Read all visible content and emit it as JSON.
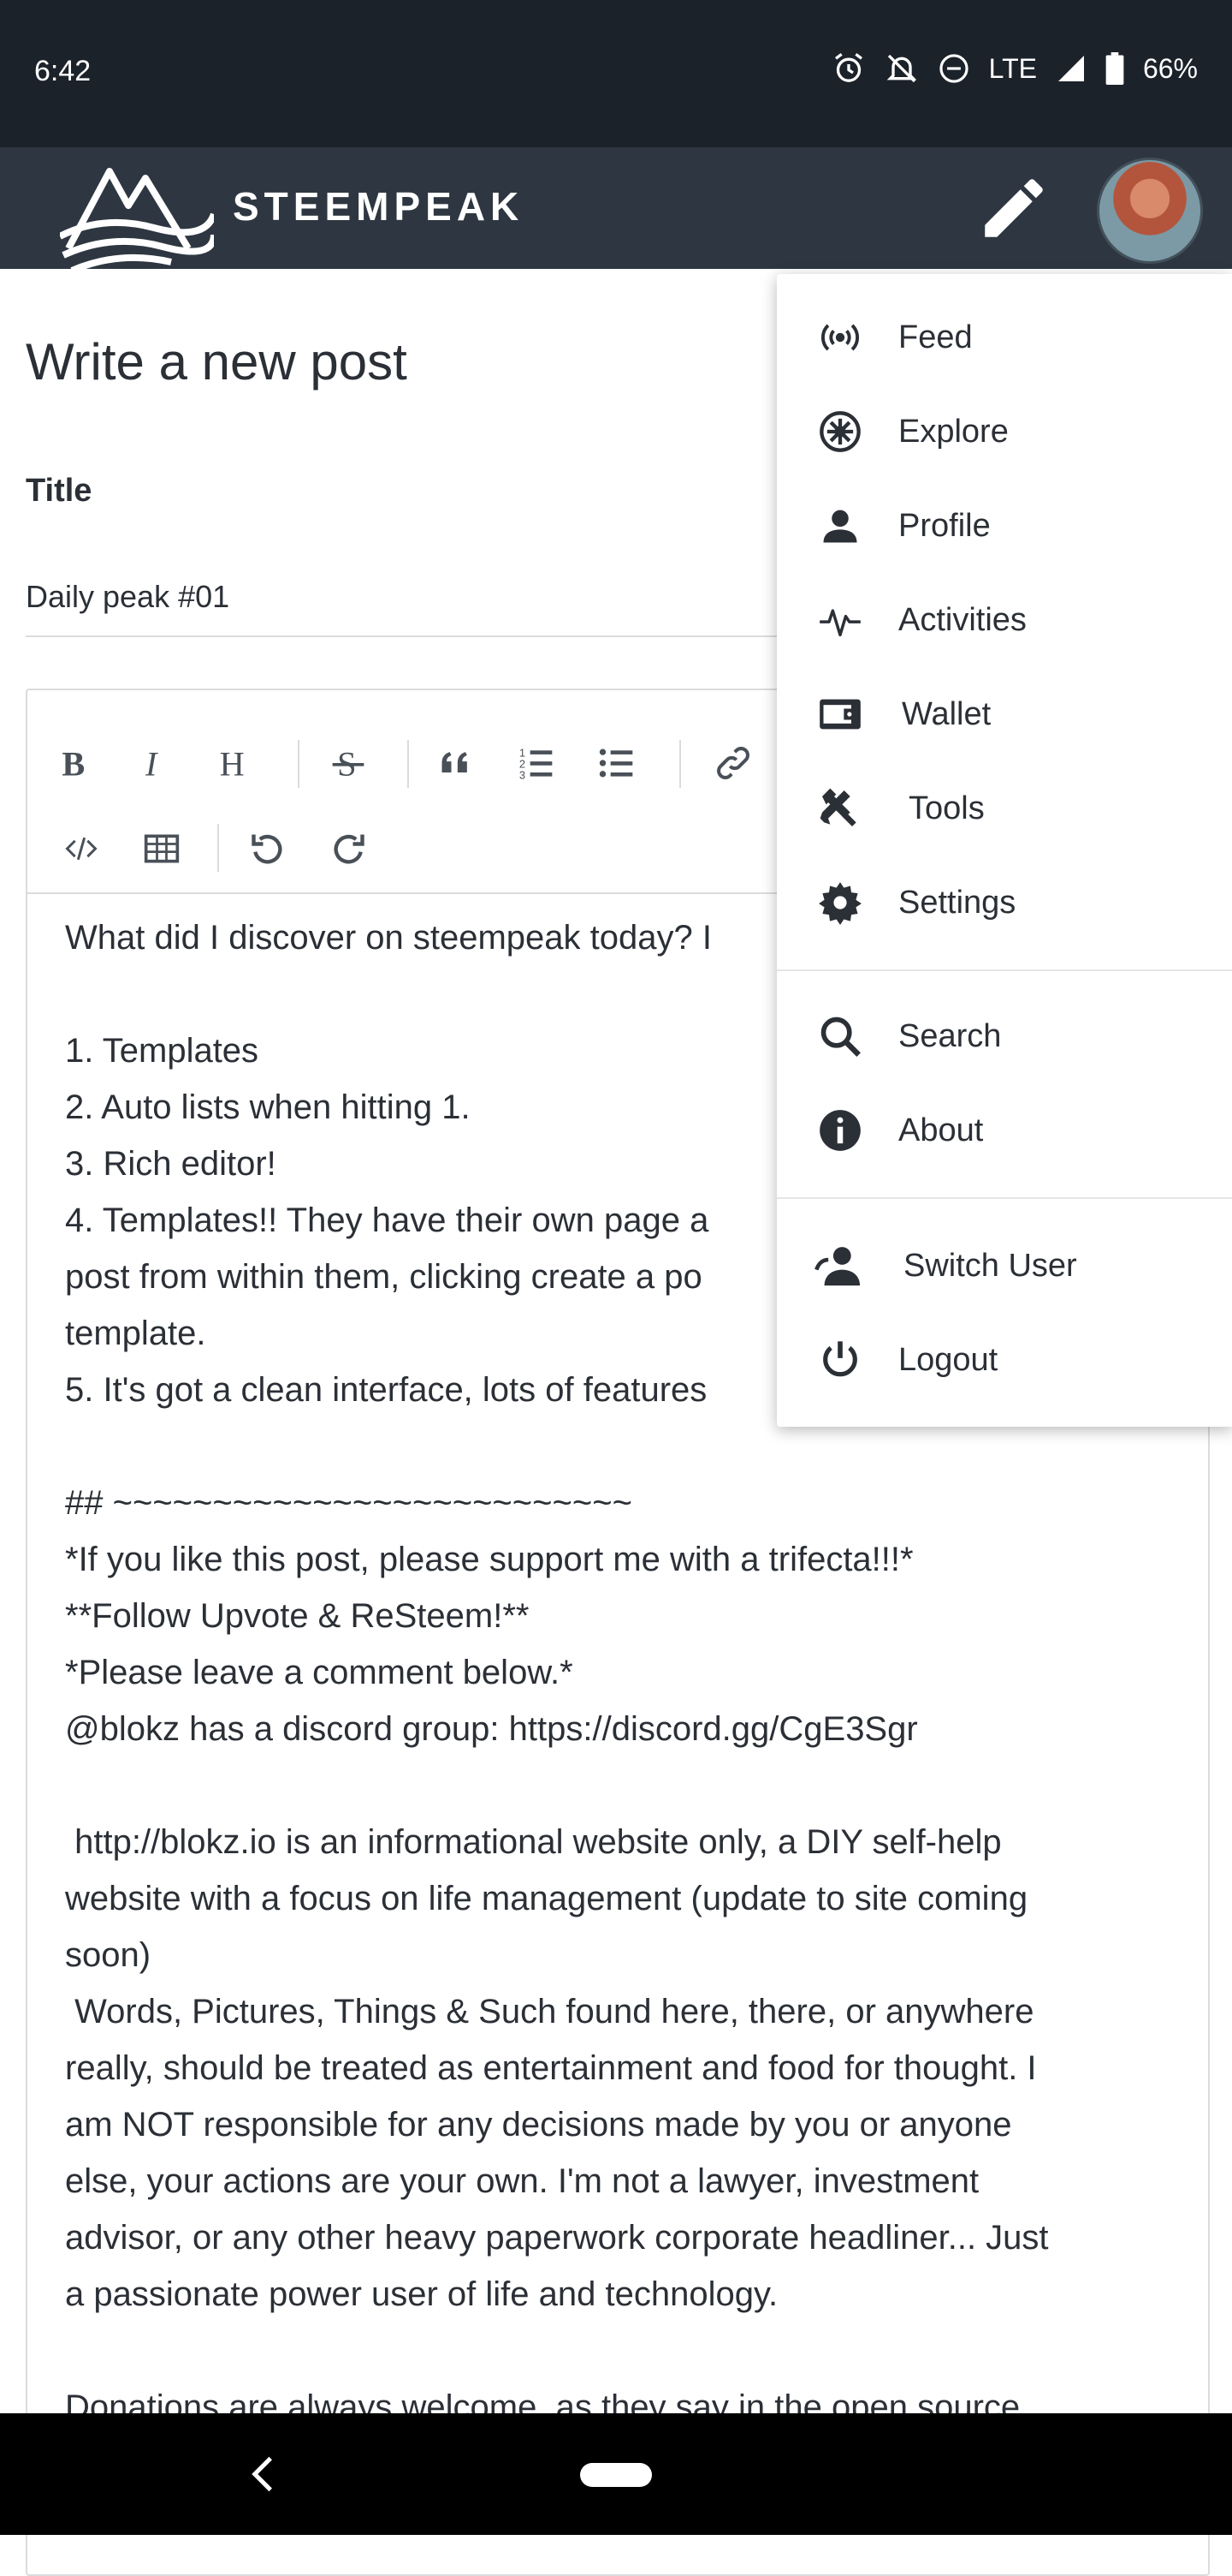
{
  "status_bar": {
    "time": "6:42",
    "network": "LTE",
    "battery": "66%",
    "icons": [
      "alarm-icon",
      "do-not-disturb-bell-icon",
      "dnd-icon",
      "signal-icon",
      "battery-icon"
    ]
  },
  "header": {
    "brand": "STEEMPEAK",
    "icons": [
      "steempeak-logo",
      "pencil-icon",
      "avatar"
    ]
  },
  "page": {
    "title": "Write a new post",
    "title_label": "Title",
    "title_value": "Daily peak #01"
  },
  "toolbar": {
    "buttons": [
      "bold",
      "italic",
      "heading",
      "strikethrough",
      "quote",
      "ordered-list",
      "unordered-list",
      "link",
      "code",
      "table",
      "undo",
      "redo"
    ]
  },
  "editor": {
    "lines": [
      "What did I discover on steempeak today? I",
      "",
      "1. Templates",
      "2. Auto lists when hitting 1.",
      "3. Rich editor!",
      "4. Templates!! They have their own page a",
      "post from within them, clicking create a po",
      "template.",
      "5. It's got a clean interface, lots of features",
      "",
      "## ~~~~~~~~~~~~~~~~~~~~~~~~~~",
      "*If you like this post, please support me with a trifecta!!!*",
      "**Follow Upvote & ReSteem!**",
      "*Please leave a comment below.*",
      "@blokz has a discord group: https://discord.gg/CgE3Sgr",
      "",
      " http://blokz.io is an informational website only, a DIY self-help",
      "website with a focus on life management (update to site coming",
      "soon)",
      " Words, Pictures, Things & Such found here, there, or anywhere",
      "really, should be treated as entertainment and food for thought. I",
      "am NOT responsible for any decisions made by you or anyone",
      "else, your actions are your own. I'm not a lawyer, investment",
      "advisor, or any other heavy paperwork corporate headliner... Just",
      "a passionate power user of life and technology.",
      "",
      "Donations are always welcome, as they say in the open source"
    ]
  },
  "menu": {
    "items": [
      {
        "label": "Feed",
        "icon": "feed-icon"
      },
      {
        "label": "Explore",
        "icon": "explore-icon"
      },
      {
        "label": "Profile",
        "icon": "profile-icon"
      },
      {
        "label": "Activities",
        "icon": "activities-icon"
      },
      {
        "label": "Wallet",
        "icon": "wallet-icon"
      },
      {
        "label": "Tools",
        "icon": "tools-icon"
      },
      {
        "label": "Settings",
        "icon": "settings-icon"
      },
      {
        "label": "Search",
        "icon": "search-icon"
      },
      {
        "label": "About",
        "icon": "about-icon"
      },
      {
        "label": "Switch User",
        "icon": "switch-user-icon"
      },
      {
        "label": "Logout",
        "icon": "logout-icon"
      }
    ]
  },
  "navbar": {
    "icons": [
      "back-icon",
      "home-pill"
    ]
  },
  "colors": {
    "status_bar": "#1c2229",
    "app_bar": "#2e3741",
    "text": "#2b2f36",
    "border": "#d9dcdf",
    "nav_bar": "#000000"
  }
}
